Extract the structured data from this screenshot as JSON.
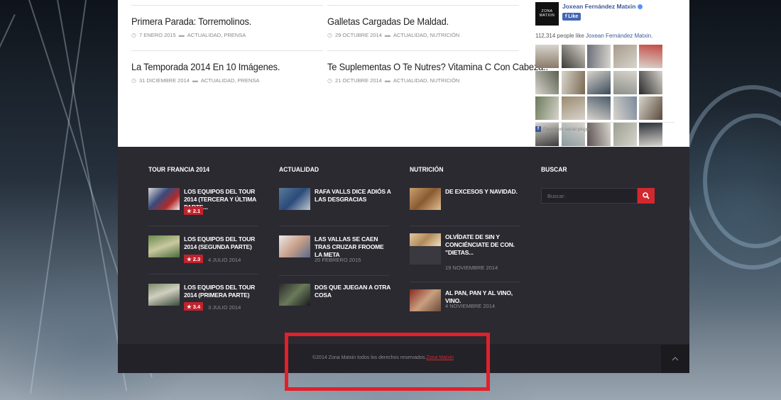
{
  "posts": [
    {
      "title": "Primera Parada: Torremolinos.",
      "date": "7 ENERO 2015",
      "categories": "ACTUALIDAD, PRENSA"
    },
    {
      "title": "Galletas Cargadas De Maldad.",
      "date": "29 OCTUBRE 2014",
      "categories": "ACTUALIDAD, NUTRICIÓN"
    },
    {
      "title": "La Temporada 2014 En 10 Imágenes.",
      "date": "31 DICIEMBRE 2014",
      "categories": "ACTUALIDAD, PRENSA"
    },
    {
      "title": "Te Suplementas O Te Nutres? Vitamina C Con Cabeza..",
      "date": "21 OCTUBRE 2014",
      "categories": "ACTUALIDAD, NUTRICIÓN"
    }
  ],
  "facebook": {
    "logo_text": "ZONA MATXIN",
    "page_name": "Joxean Fernández Matxin",
    "like_label": "Like",
    "count_text": "112,314 people like",
    "count_name": "Joxean Fernández Matxin.",
    "plugin_label": "Facebook social plugin",
    "face_colors": [
      "#8a7a6a",
      "#3c3a36",
      "#6b6f7a",
      "#a79a8c",
      "#c44a44",
      "#5a6050",
      "#7a6a52",
      "#3a4a5a",
      "#8c8f8a",
      "#2a2a2a",
      "#6a7a5a",
      "#9a8a70",
      "#4a5a6a",
      "#7a8a9a",
      "#5a4a3a",
      "#3a3a3a",
      "#8a9aa0",
      "#5a5050",
      "#9aa090",
      "#2a3038"
    ]
  },
  "footer": {
    "tour": {
      "heading": "TOUR FRANCIA 2014",
      "items": [
        {
          "title": "LOS EQUIPOS DEL TOUR 2014 (TERCERA Y ÚLTIMA PARTE...",
          "rating": "2.1",
          "date": ""
        },
        {
          "title": "LOS EQUIPOS DEL TOUR 2014 (SEGUNDA PARTE)",
          "rating": "2.3",
          "date": "4 JULIO 2014"
        },
        {
          "title": "LOS EQUIPOS DEL TOUR 2014 (PRIMERA PARTE)",
          "rating": "3.4",
          "date": "3 JULIO 2014"
        }
      ]
    },
    "actualidad": {
      "heading": "ACTUALIDAD",
      "items": [
        {
          "title": "RAFA VALLS DICE ADIÓS A LAS DESGRACIAS",
          "date": ""
        },
        {
          "title": "LAS VALLAS SE CAEN TRAS CRUZAR FROOME LA META",
          "date": "20 FEBRERO 2015"
        },
        {
          "title": "DOS QUE JUEGAN A OTRA COSA",
          "date": ""
        }
      ]
    },
    "nutricion": {
      "heading": "NUTRICIÓN",
      "items": [
        {
          "title": "DE EXCESOS Y NAVIDAD.",
          "date": ""
        },
        {
          "title": "OLVÍDATE DE SIN Y CONCIÉNCIATE DE CON. \"DIETAS...",
          "date": "19 NOVIEMBRE 2014"
        },
        {
          "title": "AL PAN, PAN Y AL VINO, VINO.",
          "date": "4 NOVIEMBRE 2014"
        }
      ]
    },
    "buscar": {
      "heading": "BUSCAR",
      "placeholder": "Buscar:"
    }
  },
  "copyright": {
    "text": "©2014 Zona Matxin todos los derechos reservados.",
    "link": "Zona Matxin"
  },
  "colors": {
    "accent": "#d2282f",
    "footer_bg": "#2b2a31",
    "highlight": "#e1202a"
  }
}
